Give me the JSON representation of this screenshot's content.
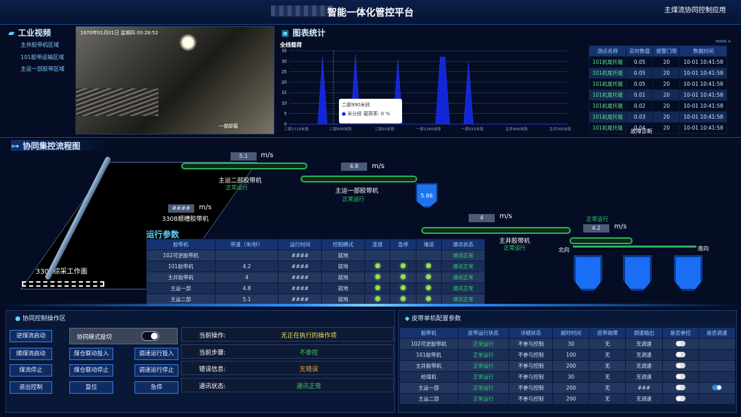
{
  "header": {
    "title": "智能一体化管控平台",
    "app": "主煤流协同控制应用"
  },
  "video": {
    "section_title": "工业视频",
    "areas": [
      "主井胶带机区域",
      "101胶带运输区域",
      "主运一部胶带区域"
    ],
    "timestamp": "1970年01月01日 星期四 00:28:52",
    "caption": "一部卸载"
  },
  "chart": {
    "section_title": "图表统计",
    "subtitle": "全线载荷",
    "more": "more >",
    "tooltip_title": "二部990米段",
    "tooltip_series": "米分段 载荷率: 0 %"
  },
  "chart_data": {
    "type": "area",
    "title": "全线载荷",
    "y_ticks": [
      0,
      5,
      10,
      15,
      20,
      25,
      30,
      35
    ],
    "ylim": [
      0,
      35
    ],
    "x_ticks": [
      "二部1710米段",
      "二部900米段",
      "二部90米段",
      "一部1260米段",
      "一部315米段",
      "主井840米段",
      "主井300米段"
    ],
    "values": [
      0,
      0,
      0,
      0,
      0,
      0,
      0,
      32,
      0,
      0,
      0,
      0,
      0,
      0,
      33,
      0,
      0,
      0,
      0,
      0,
      0,
      0,
      0,
      31,
      0,
      0,
      0,
      0,
      0,
      0,
      0,
      0,
      32,
      32,
      0,
      0,
      0,
      0,
      30,
      0,
      0,
      0,
      0,
      0,
      0,
      0,
      0,
      0,
      0,
      0,
      0,
      0,
      0,
      0,
      0,
      0,
      0,
      0,
      0,
      0
    ]
  },
  "sensors": {
    "headers": [
      "测点名称",
      "实时数值",
      "报警门限",
      "数据时间"
    ],
    "rows": [
      [
        "101机尾托辊",
        "0.05",
        "20",
        "10-01 10:41:58"
      ],
      [
        "101机尾托辊",
        "0.05",
        "20",
        "10-01 10:41:58"
      ],
      [
        "101机尾托辊",
        "0.05",
        "20",
        "10-01 10:41:58"
      ],
      [
        "101机尾托辊",
        "0.01",
        "20",
        "10-01 10:41:58"
      ],
      [
        "101机尾托辊",
        "0.02",
        "20",
        "10-01 10:41:58"
      ],
      [
        "101机尾托辊",
        "0.03",
        "20",
        "10-01 10:41:58"
      ],
      [
        "101机尾托辊",
        "0.04",
        "20",
        "10-01 10:41:58"
      ]
    ],
    "footer": "故障诊断"
  },
  "flow": {
    "section_title": "协同集控流程图",
    "workface": "3308综采工作面",
    "unit": "m/s",
    "b1": {
      "speed": "5.1",
      "name": "主运二部胶带机",
      "status": "正常运行"
    },
    "b2": {
      "speed": "4.8",
      "name": "主运一部胶带机",
      "status": "正常运行"
    },
    "b3": {
      "speed": "####",
      "name": "3308顺槽胶带机"
    },
    "b4": {
      "speed": "4",
      "name": "主井胶带机",
      "status": "正常运行"
    },
    "b5": {
      "speed": "4.2",
      "status": "正常运行",
      "north": "北向",
      "south": "南向"
    },
    "hopper": "5.86"
  },
  "params": {
    "section_title": "运行参数",
    "headers": [
      "胶带机",
      "带速（米/秒）",
      "运行时间",
      "控制模式",
      "连锁",
      "急停",
      "堵误",
      "通讯状态"
    ],
    "rows": [
      [
        "102可逆胶带机",
        "",
        "####",
        "就地",
        "",
        "",
        "",
        "通讯正常"
      ],
      [
        "101胶带机",
        "4.2",
        "####",
        "就地",
        "dot",
        "dot",
        "dot",
        "通讯正常"
      ],
      [
        "主井胶带机",
        "4",
        "####",
        "就地",
        "dot",
        "dot",
        "dot",
        "通讯正常"
      ],
      [
        "主运一部",
        "4.8",
        "####",
        "就地",
        "dot",
        "dot",
        "dot",
        "通讯正常"
      ],
      [
        "主运二部",
        "5.1",
        "####",
        "就地",
        "dot",
        "dot",
        "dot",
        "通讯正常"
      ]
    ]
  },
  "ops": {
    "section_title": "协同控制操作区",
    "buttons": [
      "逆煤流启动",
      "顺煤流启动",
      "煤流停止",
      "退出控制"
    ],
    "mode_label": "协同模式投切",
    "mid_buttons": [
      "煤仓联动投入",
      "煤仓联动停止",
      "复位"
    ],
    "right_buttons": [
      "调速运行投入",
      "调速运行停止",
      "急停"
    ],
    "status": [
      [
        "当前操作:",
        "无正在执行的操作项"
      ],
      [
        "当前步骤:",
        "不参控"
      ],
      [
        "错误信息:",
        "无错误"
      ],
      [
        "通讯状态:",
        "通讯正常"
      ]
    ]
  },
  "config": {
    "section_title": "皮带单机配置参数",
    "headers": [
      "胶带机",
      "皮带运行状态",
      "详细状态",
      "超时时间",
      "皮带故障",
      "调速输出",
      "是否参控",
      "是否调速"
    ],
    "rows": [
      [
        "102可逆胶带机",
        "正常运行",
        "不参与控制",
        "30",
        "无",
        "无调速"
      ],
      [
        "101胶带机",
        "正常运行",
        "不参与控制",
        "100",
        "无",
        "无调速"
      ],
      [
        "主井胶带机",
        "正常运行",
        "不参与控制",
        "200",
        "无",
        "无调速"
      ],
      [
        "给煤机",
        "正常运行",
        "不参与控制",
        "30",
        "无",
        "无调速"
      ],
      [
        "主运一部",
        "正常运行",
        "不参与控制",
        "200",
        "无",
        "###"
      ],
      [
        "主运二部",
        "正常运行",
        "不参与控制",
        "200",
        "无",
        "无调速"
      ]
    ]
  }
}
